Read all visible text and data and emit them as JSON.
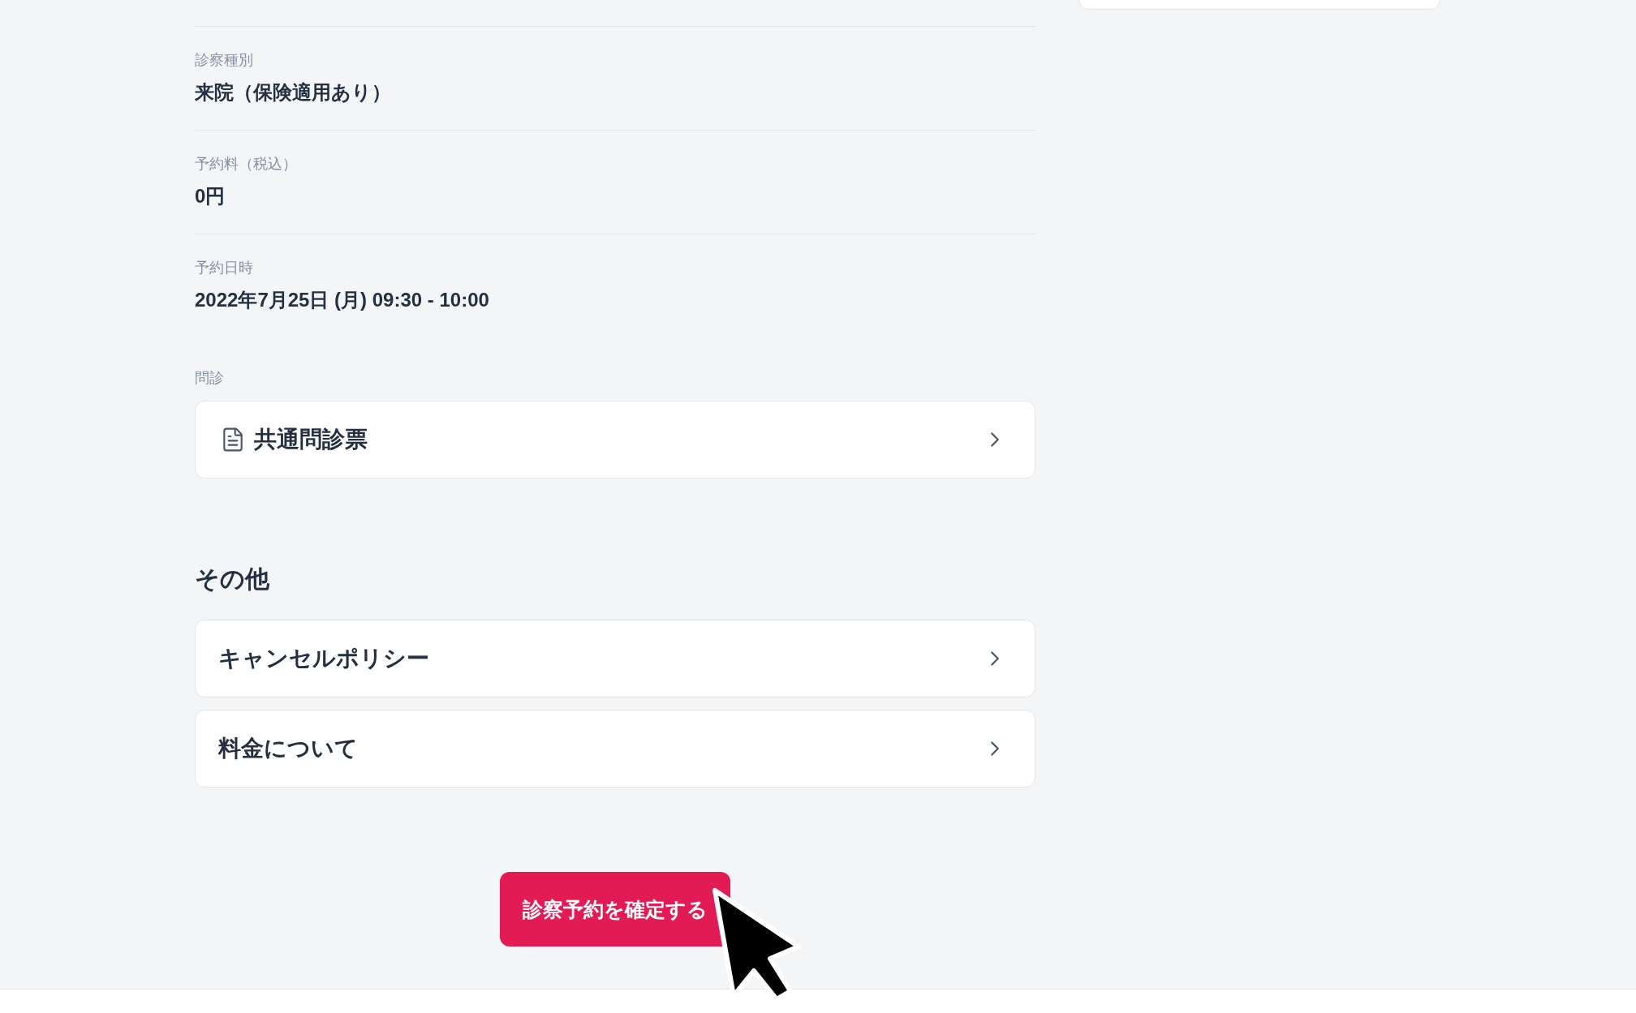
{
  "details": [
    {
      "label": "診察種別",
      "value": "来院（保険適用あり）"
    },
    {
      "label": "予約料（税込）",
      "value": "0円"
    },
    {
      "label": "予約日時",
      "value": "2022年7月25日 (月) 09:30 - 10:00"
    }
  ],
  "questionnaire": {
    "label": "問診",
    "items": [
      {
        "title": "共通問診票"
      }
    ]
  },
  "other": {
    "heading": "その他",
    "items": [
      {
        "title": "キャンセルポリシー"
      },
      {
        "title": "料金について"
      }
    ]
  },
  "confirm_button": {
    "label": "診察予約を確定する"
  }
}
